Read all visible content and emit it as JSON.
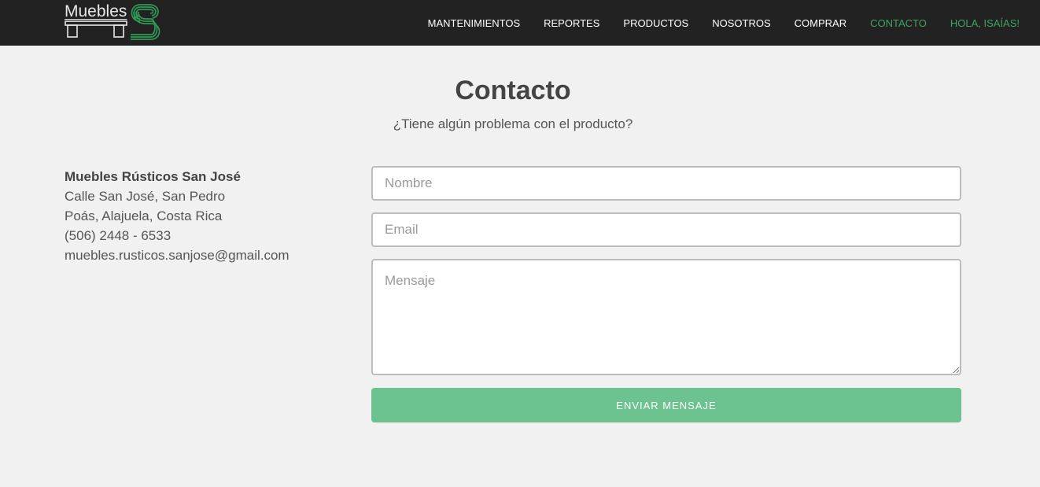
{
  "brand": {
    "logo_text": "Muebles",
    "logo_icon": "table-and-s-logo-icon",
    "accent_color": "#3fa35f"
  },
  "nav": {
    "items": [
      {
        "label": "MANTENIMIENTOS",
        "active": false
      },
      {
        "label": "REPORTES",
        "active": false
      },
      {
        "label": "PRODUCTOS",
        "active": false
      },
      {
        "label": "NOSOTROS",
        "active": false
      },
      {
        "label": "COMPRAR",
        "active": false
      },
      {
        "label": "CONTACTO",
        "active": true
      },
      {
        "label": "HOLA, ISAÍAS!",
        "active": true
      }
    ]
  },
  "page": {
    "title": "Contacto",
    "subtitle": "¿Tiene algún problema con el producto?"
  },
  "contact_info": {
    "company": "Muebles Rústicos San José",
    "address_line1": "Calle San José, San Pedro",
    "address_line2": "Poás, Alajuela, Costa Rica",
    "phone": "(506) 2448 - 6533",
    "email": "muebles.rusticos.sanjose@gmail.com"
  },
  "form": {
    "name_placeholder": "Nombre",
    "email_placeholder": "Email",
    "message_placeholder": "Mensaje",
    "name_value": "",
    "email_value": "",
    "message_value": "",
    "submit_label": "ENVIAR MENSAJE",
    "submit_color": "#6cc38f"
  }
}
